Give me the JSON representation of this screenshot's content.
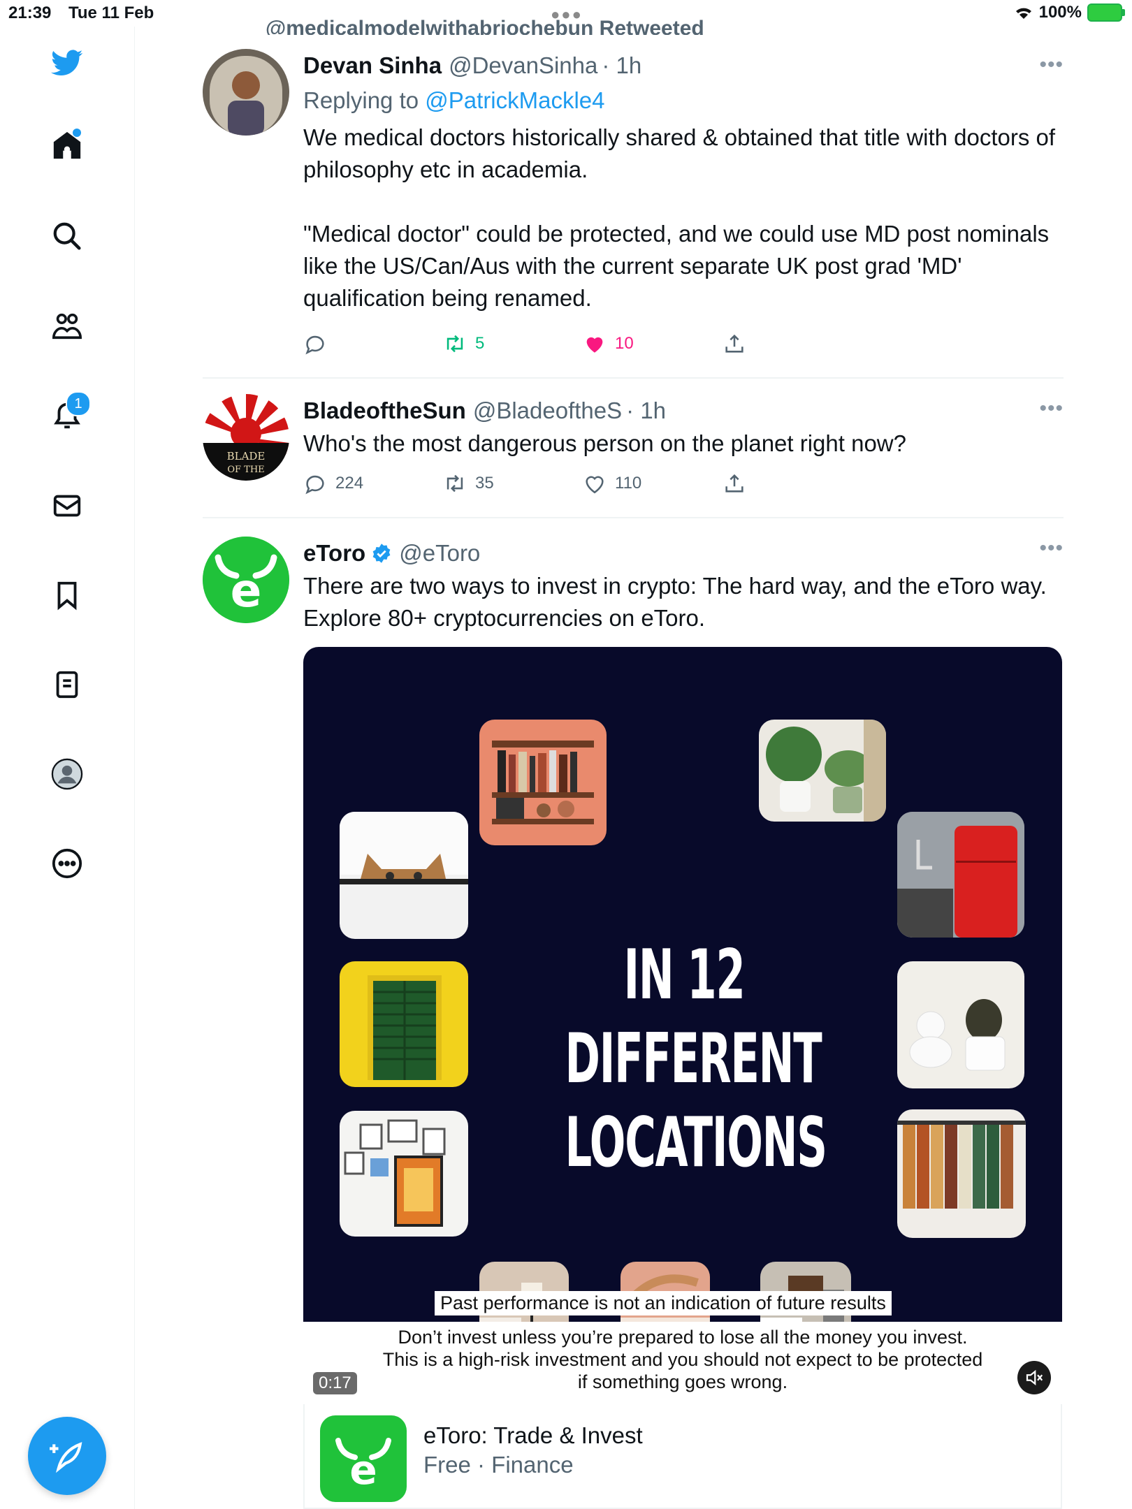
{
  "status_bar": {
    "time": "21:39",
    "date": "Tue 11 Feb",
    "battery": "100%"
  },
  "sidebar": {
    "notification_count": "1",
    "items": [
      "twitter-logo",
      "home",
      "explore",
      "communities",
      "notifications",
      "messages",
      "bookmarks",
      "lists",
      "profile",
      "more"
    ]
  },
  "retweet_line": "@medicalmodelwithabriochebun Retweeted",
  "tweets": [
    {
      "name": "Devan Sinha",
      "handle": "@DevanSinha",
      "time": "· 1h",
      "replying_prefix": "Replying to",
      "replying_to": "@PatrickMackle4",
      "text": "We medical doctors historically shared & obtained that title with doctors of philosophy etc in academia.\n\n\"Medical doctor\" could be protected, and we could use MD post nominals like the US/Can/Aus with the current separate UK post grad 'MD' qualification being renamed.",
      "replies": "",
      "retweets": "5",
      "likes": "10"
    },
    {
      "name": "BladeoftheSun",
      "handle": "@BladeoftheS",
      "time": "· 1h",
      "text": "Who's the most dangerous person on the planet right now?",
      "replies": "224",
      "retweets": "35",
      "likes": "110",
      "avatar_text": "BLADE OF THE"
    },
    {
      "name": "eToro",
      "handle": "@eToro",
      "text": "There are two ways to invest in crypto: The hard way, and the eToro way. Explore 80+ cryptocurrencies on eToro.",
      "avatar_text": "e"
    }
  ],
  "media": {
    "headline_line1": "IN 12 DIFFERENT",
    "headline_line2": "LOCATIONS",
    "past_performance": "Past performance is not an indication of future results",
    "disclaimer_line1": "Don’t invest unless you’re prepared to lose all the money you invest.",
    "disclaimer_line2": "This is a high-risk investment and you should not expect to be protected",
    "disclaimer_line3": "if something goes wrong.",
    "duration": "0:17"
  },
  "app_card": {
    "title": "eToro: Trade & Invest",
    "subtitle": "Free · Finance",
    "icon_text": "e"
  },
  "colors": {
    "accent": "#1d9bf0",
    "like": "#f91880",
    "retweet": "#00ba7c",
    "etoro_green": "#20c23a",
    "media_bg": "#080a2a"
  }
}
